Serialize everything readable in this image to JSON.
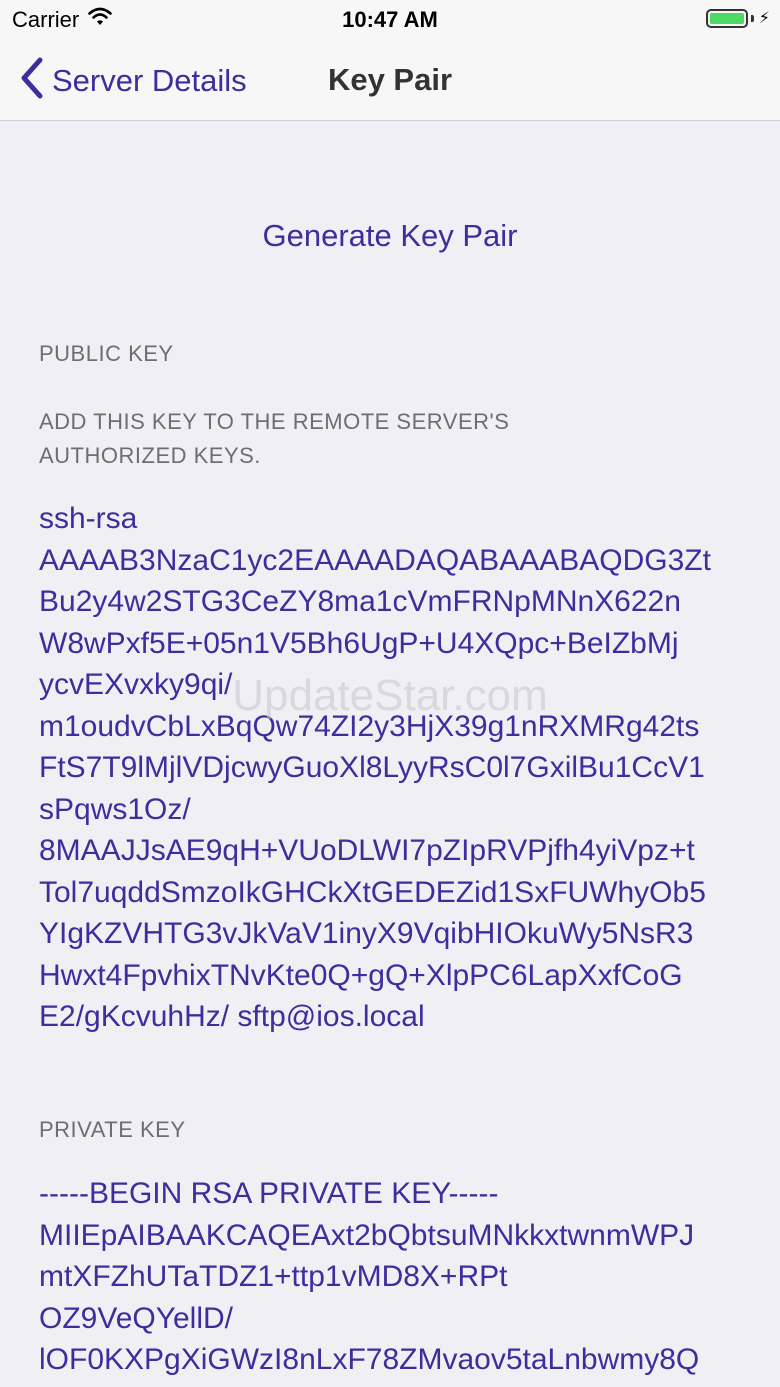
{
  "status_bar": {
    "carrier": "Carrier",
    "time": "10:47 AM",
    "battery_level": 1.0,
    "battery_color": "#4cd964",
    "icons": [
      "wifi-icon",
      "battery-icon",
      "charging-bolt-icon"
    ]
  },
  "nav": {
    "back_label": "Server Details",
    "title": "Key Pair",
    "accent_color": "#3f2d9e"
  },
  "actions": {
    "generate_label": "Generate Key Pair"
  },
  "public_key": {
    "header": "PUBLIC KEY",
    "footer": "ADD THIS KEY TO THE REMOTE SERVER'S AUTHORIZED KEYS.",
    "value": "ssh-rsa\nAAAAB3NzaC1yc2EAAAADAQABAAABAQDG3Zt\nBu2y4w2STG3CeZY8ma1cVmFRNpMNnX622n\nW8wPxf5E+05n1V5Bh6UgP+U4XQpc+BeIZbMj\nycvEXvxky9qi/\nm1oudvCbLxBqQw74ZI2y3HjX39g1nRXMRg42ts\nFtS7T9lMjlVDjcwyGuoXl8LyyRsC0l7GxilBu1CcV1\nsPqws1Oz/\n8MAAJJsAE9qH+VUoDLWI7pZIpRVPjfh4yiVpz+t\nTol7uqddSmzoIkGHCkXtGEDEZid1SxFUWhyOb5\nYIgKZVHTG3vJkVaV1inyX9VqibHIOkuWy5NsR3\nHwxt4FpvhixTNvKte0Q+gQ+XlpPC6LapXxfCoG\nE2/gKcvuhHz/ sftp@ios.local"
  },
  "private_key": {
    "header": "PRIVATE KEY",
    "value": "-----BEGIN RSA PRIVATE KEY-----\nMIIEpAIBAAKCAQEAxt2bQbtsuMNkkxtwnmWPJ\nmtXFZhUTaTDZ1+ttp1vMD8X+RPt\nOZ9VeQYellD/\nlOF0KXPgXiGWzI8nLxF78ZMvaov5taLnbwmy8Q"
  },
  "watermark": "UpdateStar.com"
}
